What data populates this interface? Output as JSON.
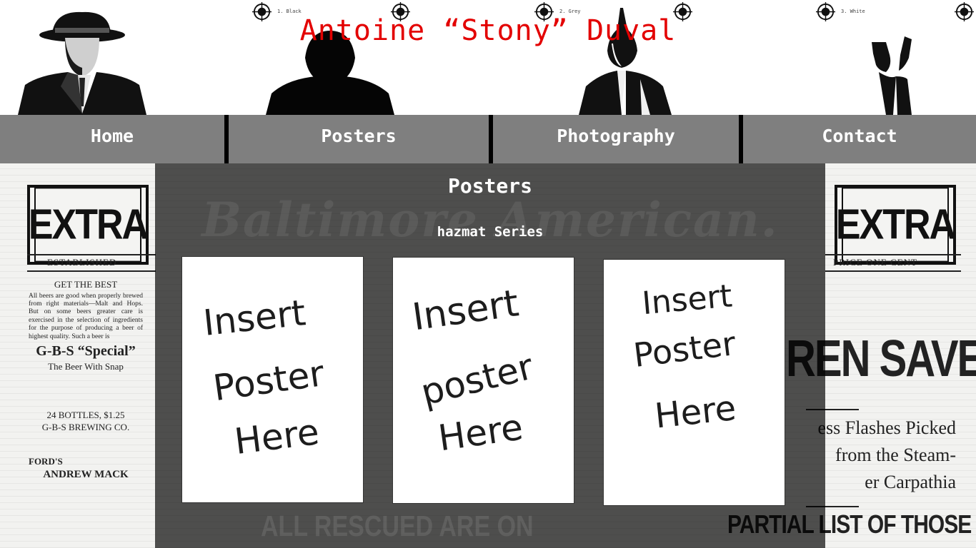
{
  "header": {
    "title": "Antoine “Stony” Duval",
    "registration_labels": [
      "1. Black",
      "2. Grey",
      "3. White"
    ]
  },
  "nav": {
    "items": [
      {
        "label": "Home"
      },
      {
        "label": "Posters"
      },
      {
        "label": "Photography"
      },
      {
        "label": "Contact"
      }
    ]
  },
  "background": {
    "extra_left": "EXTRA",
    "extra_right": "EXTRA",
    "established": "ESTABLISHED",
    "price": "PRICE ONE CENT",
    "ad_head": "GET THE BEST",
    "ad_body": "All beers are good when properly brewed from right materials—Malt and Hops. But on some beers greater care is exercised in the selection of ingredients for the purpose of producing a beer of highest quality. Such a beer is",
    "ad_big": "G-B-S “Special”",
    "ad_sub": "The Beer With Snap",
    "ad_bottles": "24 BOTTLES, $1.25",
    "ad_company": "G-B-S BREWING CO.",
    "ad_ford": "FORD'S",
    "ad_mack": "ANDREW MACK",
    "headline_saved": "REN SAVED",
    "flashes": [
      "ess Flashes Picked",
      "from the Steam-",
      "er Carpathia"
    ],
    "partial_list": "PARTIAL LIST OF THOSE",
    "masthead": "Baltimore American."
  },
  "main": {
    "title": "Posters",
    "series": "hazmat Series",
    "posters": [
      {
        "lines": [
          "Insert",
          "Poster",
          "Here"
        ]
      },
      {
        "lines": [
          "Insert",
          "poster",
          "Here"
        ]
      },
      {
        "lines": [
          "Insert",
          "Poster",
          "Here"
        ]
      }
    ]
  },
  "colors": {
    "title_red": "#e30000",
    "nav_grey": "#7f7f7f",
    "overlay": "rgba(0,0,0,0.68)"
  }
}
